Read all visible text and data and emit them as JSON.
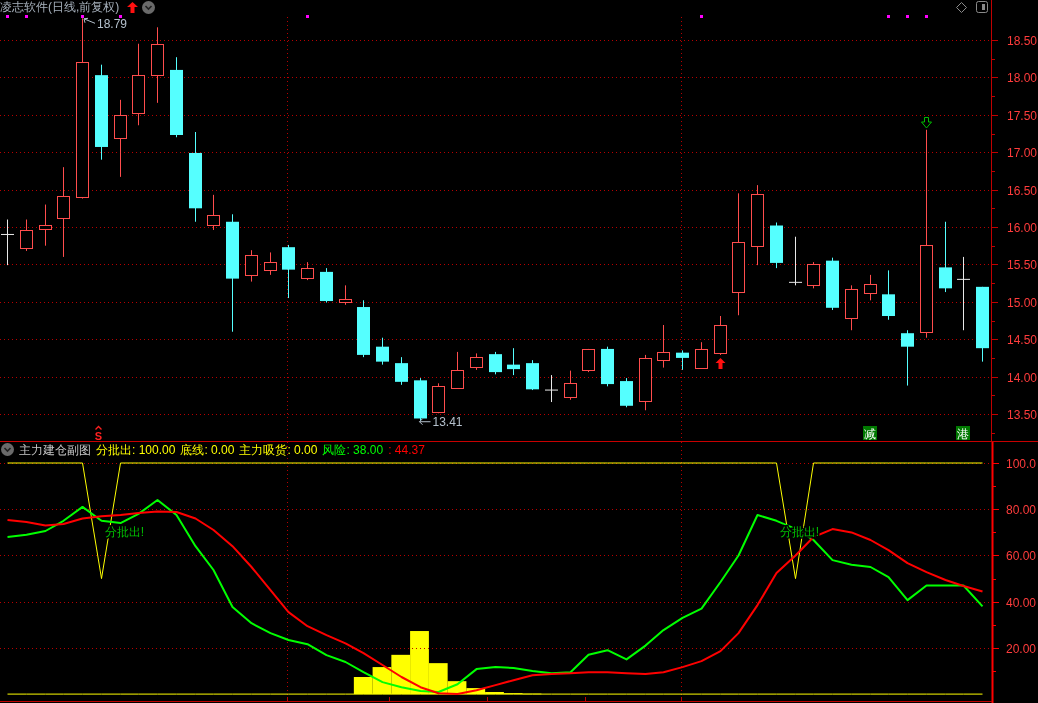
{
  "price_panel": {
    "title": "凌志软件(日线,前复权)",
    "high_label": "18.79",
    "low_label": "13.41",
    "price_axis": [
      "18.50",
      "18.00",
      "17.50",
      "17.00",
      "16.50",
      "16.00",
      "15.50",
      "15.00",
      "14.50",
      "14.00",
      "13.50"
    ],
    "markers": [
      {
        "kind": "signal",
        "text": "S"
      },
      {
        "kind": "badge",
        "text": "减"
      },
      {
        "kind": "badge",
        "text": "港"
      }
    ]
  },
  "indicator_panel": {
    "title": "主力建仓副图",
    "legend_values": [
      ": 100.00",
      ": 0.00",
      ": 0.00",
      ": 38.00",
      ": 44.37"
    ],
    "histogram": {
      "name": "主力吸货"
    },
    "chart_data": {
      "type": "line",
      "categories": [
        null,
        null,
        null,
        null,
        null,
        null,
        null,
        null,
        null,
        null,
        null,
        null,
        null,
        null,
        null,
        null,
        null,
        null,
        null,
        null,
        null,
        null,
        null,
        null,
        null,
        null,
        null,
        null,
        null,
        null,
        null,
        null,
        null,
        null,
        null,
        null,
        null,
        null,
        null,
        null,
        null,
        null,
        null,
        null,
        null,
        null,
        null,
        null,
        null,
        null,
        null,
        null,
        null
      ],
      "grid": true,
      "ylim": [
        -3.2,
        109.1
      ],
      "yticks": [
        {
          "value": 100,
          "label": "100.0"
        },
        {
          "value": 80,
          "label": "80.00"
        },
        {
          "value": 60,
          "label": "60.00"
        },
        {
          "value": 40,
          "label": "40.00"
        },
        {
          "value": 20,
          "label": "20.00"
        }
      ],
      "series": [
        {
          "name": "分批出",
          "color": "#ffff00",
          "values": [
            100,
            100,
            100,
            100,
            100,
            50,
            100,
            100,
            100,
            100,
            100,
            100,
            100,
            100,
            100,
            100,
            100,
            100,
            100,
            100,
            100,
            100,
            100,
            100,
            100,
            100,
            100,
            100,
            100,
            100,
            100,
            100,
            100,
            100,
            100,
            100,
            100,
            100,
            100,
            100,
            100,
            100,
            50,
            100,
            100,
            100,
            100,
            100,
            100,
            100,
            100,
            100,
            100
          ]
        },
        {
          "name": "底线",
          "color": "#ffff00",
          "values": [
            0,
            0,
            0,
            0,
            0,
            0,
            0,
            0,
            0,
            0,
            0,
            0,
            0,
            0,
            0,
            0,
            0,
            0,
            0,
            0,
            0,
            0,
            0,
            0,
            0,
            0,
            0,
            0,
            0,
            0,
            0,
            0,
            0,
            0,
            0,
            0,
            0,
            0,
            0,
            0,
            0,
            0,
            0,
            0,
            0,
            0,
            0,
            0,
            0,
            0,
            0,
            0,
            0
          ]
        },
        {
          "name": "风险",
          "color": "#00ff00",
          "values": [
            68,
            69,
            70.6,
            75,
            81,
            75,
            74,
            78,
            84,
            77.5,
            64,
            53.7,
            37.7,
            30.7,
            26.4,
            23.4,
            21.6,
            16.9,
            13.9,
            9.5,
            5.2,
            3,
            1.3,
            0.9,
            4.3,
            10.8,
            11.7,
            11.3,
            10,
            9,
            9.5,
            17,
            19,
            15,
            21,
            27.7,
            33,
            37,
            48.5,
            60,
            77.5,
            75,
            71.5,
            66.7,
            58,
            56,
            55,
            50.6,
            40.7,
            47,
            47,
            47,
            38
          ]
        },
        {
          "color": "#ff0000",
          "values": [
            75.3,
            74.5,
            73,
            73.6,
            76,
            77,
            77.5,
            78.4,
            79,
            78.8,
            76,
            71,
            64,
            55,
            45,
            35.5,
            29.4,
            25.5,
            22,
            17.7,
            12.6,
            7.4,
            3,
            0.4,
            0,
            1.7,
            3.9,
            6,
            8.2,
            8.7,
            9,
            9.5,
            9.5,
            9,
            8.7,
            9.5,
            11.7,
            14.3,
            18.6,
            26.4,
            38.5,
            52.4,
            60,
            68,
            71.4,
            70,
            66.7,
            62.3,
            56.7,
            52.8,
            49.4,
            46.8,
            44.4
          ]
        }
      ],
      "annotations": [
        {
          "text": "分批出!"
        },
        {
          "text": "分批出!"
        }
      ]
    }
  }
}
